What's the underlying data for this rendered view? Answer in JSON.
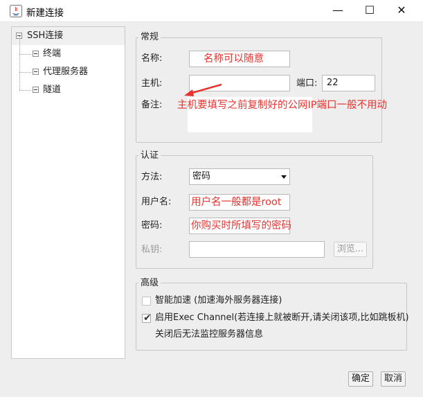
{
  "window": {
    "title": "新建连接",
    "controls": {
      "minimize": "—",
      "maximize": "☐",
      "close": "✕"
    }
  },
  "tree": {
    "root": "SSH连接",
    "children": [
      "终端",
      "代理服务器",
      "隧道"
    ]
  },
  "general": {
    "legend": "常规",
    "name_label": "名称:",
    "name_value": "名称可以随意",
    "host_label": "主机:",
    "host_value": "",
    "port_label": "端口:",
    "port_value": "22",
    "note_label": "备注:",
    "note_value": "",
    "annotation": "主机要填写之前复制好的公网IP端口一般不用动"
  },
  "auth": {
    "legend": "认证",
    "method_label": "方法:",
    "method_value": "密码",
    "user_label": "用户名:",
    "user_value": "用户名一般都是root",
    "password_label": "密码:",
    "password_value": "你购买时所填写的密码",
    "privkey_label": "私钥:",
    "privkey_value": "",
    "browse_button": "浏览..."
  },
  "advanced": {
    "legend": "高级",
    "smart_accel_label": "智能加速 (加速海外服务器连接)",
    "smart_accel_checked": false,
    "exec_channel_label": "启用Exec Channel(若连接上就被断开,请关闭该项,比如跳板机)",
    "exec_channel_checked": true,
    "exec_channel_note": "关闭后无法监控服务器信息"
  },
  "buttons": {
    "ok": "确定",
    "cancel": "取消"
  },
  "colors": {
    "annotation": "#e8322e",
    "window_bg": "#eeeeee",
    "field_bg": "#ffffff"
  }
}
